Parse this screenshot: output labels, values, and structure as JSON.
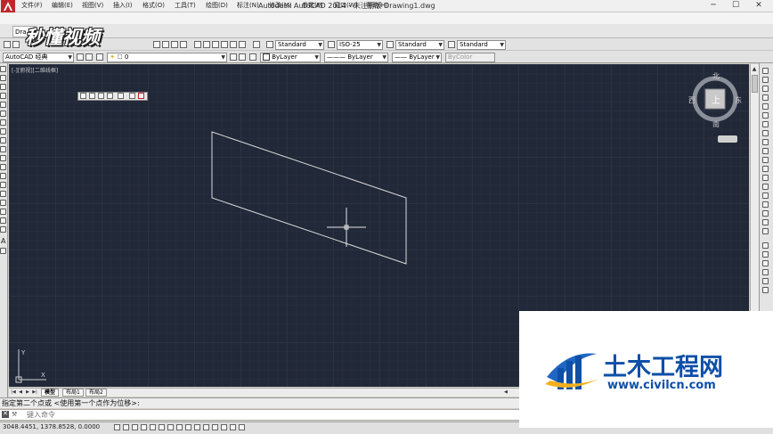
{
  "window": {
    "title": "Autodesk AutoCAD 2014 - 未注册版     Drawing1.dwg",
    "minimize": "─",
    "maximize": "☐",
    "close": "✕"
  },
  "menu": [
    "文件(F)",
    "编辑(E)",
    "视图(V)",
    "插入(I)",
    "格式(O)",
    "工具(T)",
    "绘图(D)",
    "标注(N)",
    "修改(M)",
    "参数(P)",
    "窗口(W)",
    "帮助(H)"
  ],
  "tab": {
    "label": "Dra"
  },
  "brand": "秒懂视频",
  "styles": {
    "text_style": "Standard",
    "dim_style": "ISO-25",
    "table_style": "Standard",
    "multileader_style": "Standard"
  },
  "workspace": "AutoCAD 经典",
  "layer": "0",
  "properties": {
    "color": "ByLayer",
    "linetype": "ByLayer",
    "lineweight": "ByLayer",
    "plotstyle": "ByColor"
  },
  "viewport_label": "[-][俯视][二维线框]",
  "viewcube": {
    "north": "北",
    "south": "南",
    "east": "东",
    "west": "西",
    "face": "上",
    "wcs": "WCS"
  },
  "layout_tabs": [
    "模型",
    "布局1",
    "布局2"
  ],
  "command": {
    "history": "指定第二个点或 <使用第一个点作为位移>:",
    "placeholder": "键入命令"
  },
  "status": {
    "coords": "3048.4451, 1378.8528, 0.0000"
  },
  "watermark": {
    "title": "土木工程网",
    "url": "www.civilcn.com"
  },
  "colors": {
    "canvas_bg": "#212838",
    "watermark_blue": "#0e4fa8",
    "app_logo_red": "#c0272d"
  }
}
